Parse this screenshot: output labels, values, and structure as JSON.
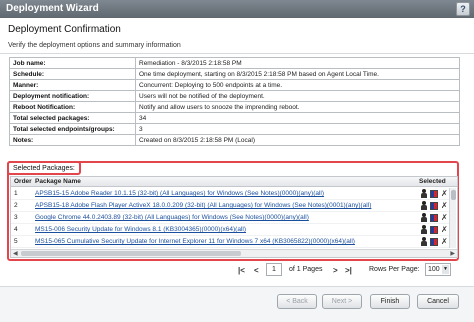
{
  "window": {
    "title": "Deployment Wizard",
    "help_label": "?"
  },
  "header": {
    "title": "Deployment Confirmation",
    "subtitle": "Verify the deployment options and summary information"
  },
  "summary": [
    {
      "label": "Job name:",
      "value": "Remediation - 8/3/2015 2:18:58 PM"
    },
    {
      "label": "Schedule:",
      "value": "One time deployment, starting on 8/3/2015 2:18:58 PM based on Agent Local Time."
    },
    {
      "label": "Manner:",
      "value": "Concurrent: Deploying to 500 endpoints at a time."
    },
    {
      "label": "Deployment notification:",
      "value": "Users will not be notified of the deployment."
    },
    {
      "label": "Reboot Notification:",
      "value": "Notify and allow users to snooze the imprending reboot."
    },
    {
      "label": "Total selected packages:",
      "value": "34"
    },
    {
      "label": "Total selected endpoints/groups:",
      "value": "3"
    },
    {
      "label": "Notes:",
      "value": "Created on 8/3/2015 2:18:58 PM (Local)"
    }
  ],
  "selected_packages": {
    "section_label": "Selected Packages:",
    "columns": {
      "order": "Order",
      "name": "Package Name",
      "selected": "Selected"
    },
    "rows": [
      {
        "order": "1",
        "name": "APSB15-15 Adobe Reader 10.1.15 (32-bit) (All Languages) for Windows (See Notes)(0000)(any)(all)"
      },
      {
        "order": "2",
        "name": "APSB15-18 Adobe Flash Player ActiveX 18.0.0.209 (32-bit) (All Languages) for Windows (See Notes)(0001)(any)(all)"
      },
      {
        "order": "3",
        "name": "Google Chrome 44.0.2403.89 (32-bit) (All Languages) for Windows (See Notes)(0000)(any)(all)"
      },
      {
        "order": "4",
        "name": "MS15-006 Security Update for Windows 8.1 (KB3004365)(0000)(x64)(all)"
      },
      {
        "order": "5",
        "name": "MS15-065 Cumulative Security Update for Internet Explorer 11 for Windows 7 x64 (KB3065822)(0000)(x64)(all)"
      }
    ]
  },
  "pager": {
    "first": "|<",
    "prev": "<",
    "page_value": "1",
    "of_pages": "of 1 Pages",
    "next": ">",
    "last": ">|",
    "rows_per_page_label": "Rows Per Page:",
    "rows_per_page_value": "100"
  },
  "footer": {
    "back": "< Back",
    "next": "Next >",
    "finish": "Finish",
    "cancel": "Cancel"
  }
}
